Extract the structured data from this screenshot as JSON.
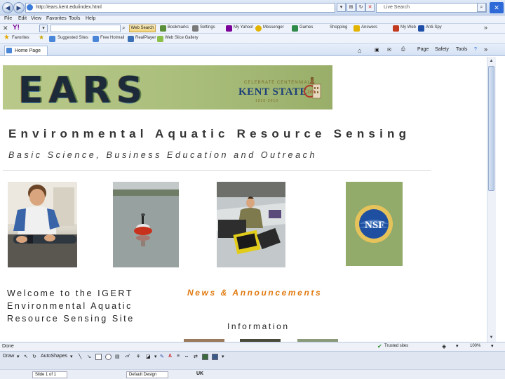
{
  "browser": {
    "address": "http://ears.kent.edu/index.html",
    "search_placeholder": "Live Search",
    "menu": [
      "File",
      "Edit",
      "View",
      "Favorites",
      "Tools",
      "Help"
    ],
    "yahoo_toolbar": {
      "logo": "Y!",
      "search_button": "Web Search",
      "items": [
        "Bookmarks",
        "Settings",
        "My Yahoo!",
        "Messenger",
        "Games",
        "Shopping",
        "Answers",
        "My Web",
        "Anti-Spy"
      ],
      "more": "»"
    },
    "favorites": {
      "label": "Favorites",
      "items": [
        "Suggested Sites",
        "Free Hotmail",
        "RealPlayer",
        "Web Slice Gallery"
      ]
    },
    "tab": {
      "title": "Home Page"
    },
    "commands": [
      "Page",
      "Safety",
      "Tools"
    ],
    "status": {
      "left": "Done",
      "zone": "Trusted sites",
      "zoom": "100%"
    }
  },
  "page": {
    "banner_text": "EARS",
    "kent": {
      "tagline": "CELEBRATE CENTENNIAL",
      "name": "KENT STATE",
      "years": "1910-2010",
      "seal_number": "100"
    },
    "title": "Environmental Aquatic Resource Sensing",
    "subtitle": "Basic Science, Business Education and Outreach",
    "welcome_lines": [
      "Welcome to the IGERT",
      "Environmental Aquatic",
      "Resource Sensing Site"
    ],
    "news_heading": "News & Announcements",
    "info_heading": "Information",
    "nsf_logo": "NSF"
  },
  "office_toolbar": {
    "draw_label": "Draw",
    "autoshapes_label": "AutoShapes",
    "slide_indicator": "Slide 1 of 1",
    "design_label": "Default Design",
    "language": "UK"
  },
  "colors": {
    "accent_orange": "#e07a10",
    "banner_green": "#b9c98a",
    "ie_blue": "#2d6ad8"
  }
}
